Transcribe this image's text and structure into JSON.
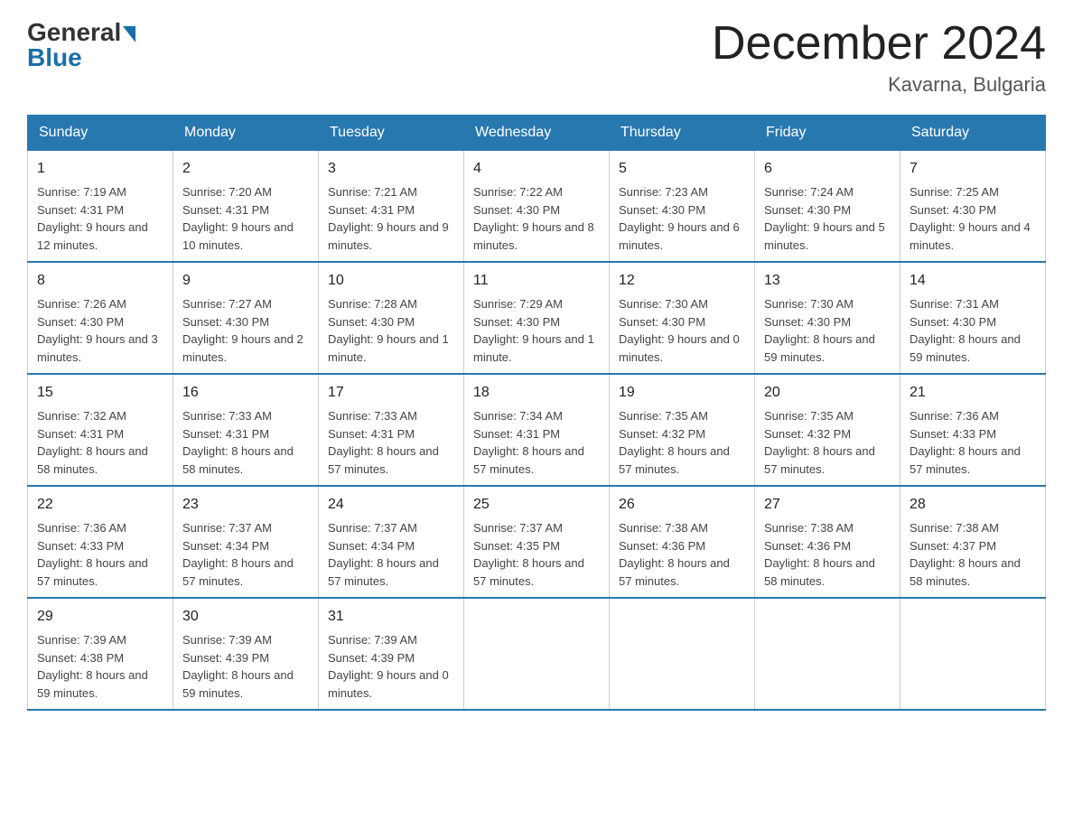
{
  "header": {
    "logo_general": "General",
    "logo_blue": "Blue",
    "month_title": "December 2024",
    "location": "Kavarna, Bulgaria"
  },
  "days_of_week": [
    "Sunday",
    "Monday",
    "Tuesday",
    "Wednesday",
    "Thursday",
    "Friday",
    "Saturday"
  ],
  "weeks": [
    [
      {
        "day": "1",
        "sunrise": "7:19 AM",
        "sunset": "4:31 PM",
        "daylight": "9 hours and 12 minutes."
      },
      {
        "day": "2",
        "sunrise": "7:20 AM",
        "sunset": "4:31 PM",
        "daylight": "9 hours and 10 minutes."
      },
      {
        "day": "3",
        "sunrise": "7:21 AM",
        "sunset": "4:31 PM",
        "daylight": "9 hours and 9 minutes."
      },
      {
        "day": "4",
        "sunrise": "7:22 AM",
        "sunset": "4:30 PM",
        "daylight": "9 hours and 8 minutes."
      },
      {
        "day": "5",
        "sunrise": "7:23 AM",
        "sunset": "4:30 PM",
        "daylight": "9 hours and 6 minutes."
      },
      {
        "day": "6",
        "sunrise": "7:24 AM",
        "sunset": "4:30 PM",
        "daylight": "9 hours and 5 minutes."
      },
      {
        "day": "7",
        "sunrise": "7:25 AM",
        "sunset": "4:30 PM",
        "daylight": "9 hours and 4 minutes."
      }
    ],
    [
      {
        "day": "8",
        "sunrise": "7:26 AM",
        "sunset": "4:30 PM",
        "daylight": "9 hours and 3 minutes."
      },
      {
        "day": "9",
        "sunrise": "7:27 AM",
        "sunset": "4:30 PM",
        "daylight": "9 hours and 2 minutes."
      },
      {
        "day": "10",
        "sunrise": "7:28 AM",
        "sunset": "4:30 PM",
        "daylight": "9 hours and 1 minute."
      },
      {
        "day": "11",
        "sunrise": "7:29 AM",
        "sunset": "4:30 PM",
        "daylight": "9 hours and 1 minute."
      },
      {
        "day": "12",
        "sunrise": "7:30 AM",
        "sunset": "4:30 PM",
        "daylight": "9 hours and 0 minutes."
      },
      {
        "day": "13",
        "sunrise": "7:30 AM",
        "sunset": "4:30 PM",
        "daylight": "8 hours and 59 minutes."
      },
      {
        "day": "14",
        "sunrise": "7:31 AM",
        "sunset": "4:30 PM",
        "daylight": "8 hours and 59 minutes."
      }
    ],
    [
      {
        "day": "15",
        "sunrise": "7:32 AM",
        "sunset": "4:31 PM",
        "daylight": "8 hours and 58 minutes."
      },
      {
        "day": "16",
        "sunrise": "7:33 AM",
        "sunset": "4:31 PM",
        "daylight": "8 hours and 58 minutes."
      },
      {
        "day": "17",
        "sunrise": "7:33 AM",
        "sunset": "4:31 PM",
        "daylight": "8 hours and 57 minutes."
      },
      {
        "day": "18",
        "sunrise": "7:34 AM",
        "sunset": "4:31 PM",
        "daylight": "8 hours and 57 minutes."
      },
      {
        "day": "19",
        "sunrise": "7:35 AM",
        "sunset": "4:32 PM",
        "daylight": "8 hours and 57 minutes."
      },
      {
        "day": "20",
        "sunrise": "7:35 AM",
        "sunset": "4:32 PM",
        "daylight": "8 hours and 57 minutes."
      },
      {
        "day": "21",
        "sunrise": "7:36 AM",
        "sunset": "4:33 PM",
        "daylight": "8 hours and 57 minutes."
      }
    ],
    [
      {
        "day": "22",
        "sunrise": "7:36 AM",
        "sunset": "4:33 PM",
        "daylight": "8 hours and 57 minutes."
      },
      {
        "day": "23",
        "sunrise": "7:37 AM",
        "sunset": "4:34 PM",
        "daylight": "8 hours and 57 minutes."
      },
      {
        "day": "24",
        "sunrise": "7:37 AM",
        "sunset": "4:34 PM",
        "daylight": "8 hours and 57 minutes."
      },
      {
        "day": "25",
        "sunrise": "7:37 AM",
        "sunset": "4:35 PM",
        "daylight": "8 hours and 57 minutes."
      },
      {
        "day": "26",
        "sunrise": "7:38 AM",
        "sunset": "4:36 PM",
        "daylight": "8 hours and 57 minutes."
      },
      {
        "day": "27",
        "sunrise": "7:38 AM",
        "sunset": "4:36 PM",
        "daylight": "8 hours and 58 minutes."
      },
      {
        "day": "28",
        "sunrise": "7:38 AM",
        "sunset": "4:37 PM",
        "daylight": "8 hours and 58 minutes."
      }
    ],
    [
      {
        "day": "29",
        "sunrise": "7:39 AM",
        "sunset": "4:38 PM",
        "daylight": "8 hours and 59 minutes."
      },
      {
        "day": "30",
        "sunrise": "7:39 AM",
        "sunset": "4:39 PM",
        "daylight": "8 hours and 59 minutes."
      },
      {
        "day": "31",
        "sunrise": "7:39 AM",
        "sunset": "4:39 PM",
        "daylight": "9 hours and 0 minutes."
      },
      null,
      null,
      null,
      null
    ]
  ],
  "labels": {
    "sunrise_prefix": "Sunrise: ",
    "sunset_prefix": "Sunset: ",
    "daylight_prefix": "Daylight: "
  }
}
